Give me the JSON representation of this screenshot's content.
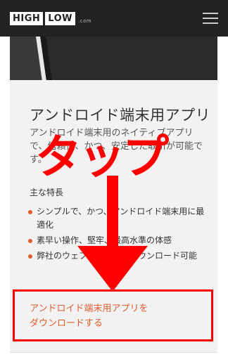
{
  "header": {
    "logo_high": "HIGH",
    "logo_low": "LOW",
    "logo_com": ".com",
    "menu_icon": "hamburger-icon"
  },
  "card": {
    "title": "アンドロイド端末用アプリ",
    "description": "アンドロイド端末用のネイティブアプリで、信頼性、かつ、安定した取引が可能です。",
    "features_title": "主な特長",
    "features": [
      "シンプルで、かつ、アンドロイド端末用に最適化",
      "素早い操作、堅牢、最高水準の体感",
      "弊社のウェブサイトからダウンロード可能"
    ],
    "download_line1": "アンドロイド端末用アプリを",
    "download_line2": "ダウンロードする"
  },
  "overlay": {
    "text": "タップ",
    "color": "#ff0000"
  },
  "colors": {
    "accent": "#e05c2f",
    "header_bg": "#222222"
  }
}
